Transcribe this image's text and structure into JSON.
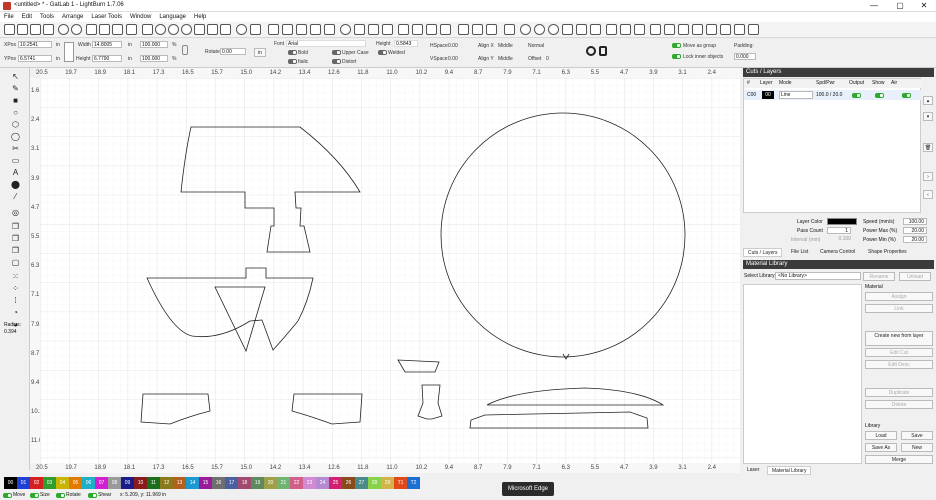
{
  "window": {
    "title": "<untitled> * - GatLab 1 - LightBurn 1.7.06",
    "minimize": "—",
    "maximize": "▢",
    "close": "✕"
  },
  "menu": [
    "File",
    "Edit",
    "Tools",
    "Arrange",
    "Laser Tools",
    "Window",
    "Language",
    "Help"
  ],
  "props": {
    "xpos_label": "XPos",
    "xpos": "10.2541",
    "ypos_label": "YPos",
    "ypos": "6.5741",
    "width_label": "Width",
    "width": "14.8005",
    "height_label": "Height",
    "height": "6.7790",
    "unit": "in",
    "scale_w": "100.000",
    "scale_h": "100.000",
    "pct": "%",
    "rotate_label": "Rotate",
    "rotate": "0.00",
    "in_btn": "in",
    "font_label": "Font",
    "font": "Arial",
    "fheight_label": "Height",
    "fheight": "0.5843",
    "bold": "Bold",
    "italic": "Italic",
    "upper": "Upper Case",
    "welded": "Welded",
    "distort": "Distort",
    "hspace_label": "HSpace",
    "hspace": "0.00",
    "vspace_label": "VSpace",
    "vspace": "0.00",
    "alignx_label": "Align X",
    "alignx": "Middle",
    "aligny_label": "Align Y",
    "aligny": "Middle",
    "normal": "Normal",
    "offset_label": "Offset",
    "offset": "0",
    "move_group": "Move as group",
    "lock_inner": "Lock inner objects",
    "padding_label": "Padding:",
    "padding": "0.000"
  },
  "ruler": {
    "top": [
      "20.5",
      "19.7",
      "18.9",
      "18.1",
      "17.3",
      "16.5",
      "15.7",
      "15.0",
      "14.2",
      "13.4",
      "12.6",
      "11.8",
      "11.0",
      "10.2",
      "9.4",
      "8.7",
      "7.9",
      "7.1",
      "6.3",
      "5.5",
      "4.7",
      "3.9",
      "3.1",
      "2.4"
    ],
    "left": [
      "1.6",
      "2.4",
      "3.1",
      "3.9",
      "4.7",
      "5.5",
      "6.3",
      "7.1",
      "7.9",
      "8.7",
      "9.4",
      "10.2",
      "11.0"
    ]
  },
  "left_tools": {
    "radius_label": "Radius:",
    "radius": "0.394"
  },
  "cuts": {
    "title": "Cuts / Layers",
    "headers": [
      "#",
      "Layer",
      "Mode",
      "Spd/Pwr",
      "Output",
      "Show",
      "Air"
    ],
    "row": {
      "num": "C00",
      "layer": "00",
      "mode": "Line",
      "spdpwr": "100.0 / 20.0"
    },
    "layer_color_label": "Layer Color",
    "speed_label": "Speed (mm/s)",
    "speed": "100.00",
    "pass_label": "Pass Count",
    "pass": "1",
    "pmax_label": "Power Max (%)",
    "pmax": "20.00",
    "interval_label": "Interval (mm)",
    "interval": "0.100",
    "pmin_label": "Power Min (%)",
    "pmin": "20.00",
    "tabs": [
      "Cuts / Layers",
      "File List",
      "Camera Control",
      "Shape Properties"
    ]
  },
  "material": {
    "title": "Material Library",
    "select_label": "Select Library",
    "select_value": "<No Library>",
    "rename": "Rename",
    "unload": "Unload",
    "material_label": "Material",
    "assign": "Assign",
    "link": "Link",
    "create_new": "Create new from layer",
    "edit_cut": "Edit Cut",
    "edit_desc": "Edit Desc",
    "duplicate": "Duplicate",
    "delete": "Delete",
    "library_label": "Library",
    "load": "Load",
    "save": "Save",
    "save_as": "Save As",
    "new": "New",
    "merge": "Merge"
  },
  "bottom_tabs": [
    "Laser",
    "Material Library"
  ],
  "palette": [
    {
      "label": "00",
      "color": "#000000"
    },
    {
      "label": "01",
      "color": "#1f3fd6"
    },
    {
      "label": "02",
      "color": "#d62020"
    },
    {
      "label": "03",
      "color": "#2f9e2f"
    },
    {
      "label": "04",
      "color": "#c9b400"
    },
    {
      "label": "05",
      "color": "#e07a00"
    },
    {
      "label": "06",
      "color": "#1fb0c9"
    },
    {
      "label": "07",
      "color": "#d21fd2"
    },
    {
      "label": "08",
      "color": "#9a9a9a"
    },
    {
      "label": "09",
      "color": "#1b1b8a"
    },
    {
      "label": "10",
      "color": "#8a1b1b"
    },
    {
      "label": "11",
      "color": "#1b6e1b"
    },
    {
      "label": "12",
      "color": "#8a7a1b"
    },
    {
      "label": "13",
      "color": "#b45f1b"
    },
    {
      "label": "14",
      "color": "#1b9ad2"
    },
    {
      "label": "15",
      "color": "#9a1b9a"
    },
    {
      "label": "16",
      "color": "#6f6f6f"
    },
    {
      "label": "17",
      "color": "#4a5fa0"
    },
    {
      "label": "18",
      "color": "#a04a6f"
    },
    {
      "label": "19",
      "color": "#5f8a5f"
    },
    {
      "label": "20",
      "color": "#a0a04a"
    },
    {
      "label": "21",
      "color": "#6fb46f"
    },
    {
      "label": "22",
      "color": "#d25f8a"
    },
    {
      "label": "23",
      "color": "#d28ad2"
    },
    {
      "label": "24",
      "color": "#b48ad2"
    },
    {
      "label": "25",
      "color": "#d21f6f"
    },
    {
      "label": "26",
      "color": "#8a4a1b"
    },
    {
      "label": "27",
      "color": "#4a8a8a"
    },
    {
      "label": "28",
      "color": "#8ad24a"
    },
    {
      "label": "29",
      "color": "#d2b44a"
    },
    {
      "label": "T1",
      "color": "#e04a1b"
    },
    {
      "label": "T2",
      "color": "#1b6ed2"
    }
  ],
  "status": {
    "move": "Move",
    "size": "Size",
    "rotate": "Rotate",
    "shear": "Shear",
    "coords": "x: 5.209, y: 11.969 in"
  },
  "tooltip": "Microsoft Edge"
}
